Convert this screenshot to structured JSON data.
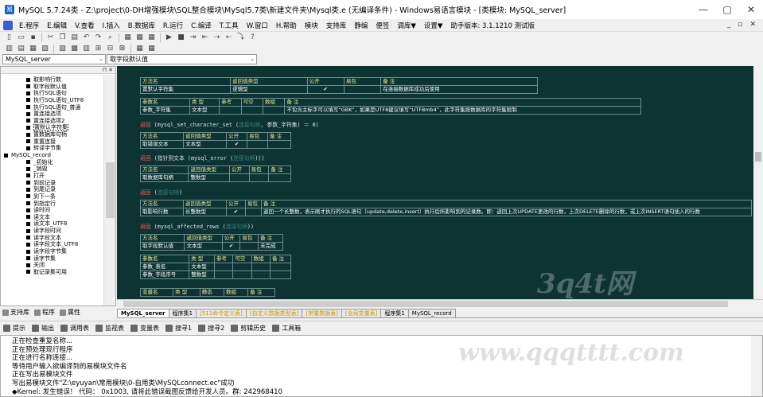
{
  "window": {
    "title": "MySQL 5.7.24类 - Z:\\project\\0-DH增强模块\\SQL整合模块\\MySql5.7类\\新建文件夹\\Mysql类.e (无编译条件) - Windows易语言模块 - [类模块: MySQL_server]",
    "controls": [
      "—",
      "▢",
      "✕"
    ]
  },
  "menu": {
    "items": [
      "E.程序",
      "E.编辑",
      "V.查看",
      "I.插入",
      "B.数据库",
      "R.运行",
      "C.编译",
      "T.工具",
      "W.窗口",
      "H.帮助",
      "模块",
      "支持库",
      "静编",
      "便签",
      "调库▼",
      "设置▼",
      "助手版本: 3.1.1210 测试版"
    ],
    "right": "_ ▫ ✕"
  },
  "combos": {
    "left": "MySQL_server",
    "right": "取字段默认值"
  },
  "tree": {
    "collapse_label": "⊓ ✕",
    "items": [
      {
        "label": "取影响行数",
        "level": 2
      },
      {
        "label": "取字段默认值",
        "level": 2
      },
      {
        "label": "执行SQL语句",
        "level": 2
      },
      {
        "label": "执行SQL语句_UTF8",
        "level": 2
      },
      {
        "label": "执行SQL语句_普通",
        "level": 2
      },
      {
        "label": "置连接选项",
        "level": 2
      },
      {
        "label": "置连接选项2",
        "level": 2
      },
      {
        "label": "置默认字符集",
        "level": 2,
        "selected": true
      },
      {
        "label": "置数据库句柄",
        "level": 2
      },
      {
        "label": "重置连接",
        "level": 2
      },
      {
        "label": "转译字节集",
        "level": 2
      },
      {
        "label": "MySQL_record",
        "level": 0
      },
      {
        "label": "_初始化",
        "level": 2
      },
      {
        "label": "_销毁",
        "level": 2
      },
      {
        "label": "打开",
        "level": 2
      },
      {
        "label": "到前记录",
        "level": 2
      },
      {
        "label": "到尾记录",
        "level": 2
      },
      {
        "label": "到下一条",
        "level": 2
      },
      {
        "label": "到指定行",
        "level": 2
      },
      {
        "label": "读时间",
        "level": 2
      },
      {
        "label": "读文本",
        "level": 2
      },
      {
        "label": "读文本_UTF8",
        "level": 2
      },
      {
        "label": "读字段时间",
        "level": 2
      },
      {
        "label": "读字段文本",
        "level": 2
      },
      {
        "label": "读字段文本_UTF8",
        "level": 2
      },
      {
        "label": "读字段字节集",
        "level": 2
      },
      {
        "label": "读字节集",
        "level": 2
      },
      {
        "label": "关闭",
        "level": 2
      },
      {
        "label": "取记录集可用",
        "level": 2
      }
    ]
  },
  "left_tabs": [
    "支持库",
    "程序",
    "属性"
  ],
  "code": {
    "t1": {
      "header": [
        "方法名",
        "返回值类型",
        "公开",
        "易包",
        "备 注"
      ],
      "row": [
        "置默认字符集",
        "逻辑型",
        "✔",
        "",
        "在连接数据库成功后使用"
      ],
      "pheader": [
        "参数名",
        "类 型",
        "参考",
        "可空",
        "数组",
        "备 注"
      ],
      "prow": [
        "参数_字符集",
        "文本型",
        "",
        "",
        "",
        "不包含主标字可以填写“GBK”，如果是UTF8建议填写“UTF8mb4”，此字符集按数据库的字符集限制"
      ]
    },
    "l1": {
      "kw": "返回",
      "text": " (mysql_set_character_set (",
      "hidden": "连接句柄",
      "tail": ", 参数_字符集) ＝ 0)"
    },
    "t2": {
      "header": [
        "方法名",
        "返回值类型",
        "公开",
        "易包",
        "备 注"
      ],
      "row": [
        "取错误文本",
        "文本型",
        "✔",
        "",
        ""
      ]
    },
    "l2": {
      "kw": "返回",
      "text": " (指针到文本 (mysql_error (",
      "hidden": "连接句柄",
      "tail": ")))"
    },
    "t3": {
      "header": [
        "方法名",
        "返回值类型",
        "公开",
        "易包",
        "备 注"
      ],
      "row": [
        "取数据库句柄",
        "整数型",
        "",
        "",
        ""
      ]
    },
    "l3": {
      "kw": "返回",
      "text": " (",
      "hidden": "连接句柄",
      "tail": ")"
    },
    "t4": {
      "header": [
        "方法名",
        "返回值类型",
        "公开",
        "易包",
        "备 注"
      ],
      "row": [
        "取影响行数",
        "长整数型",
        "✔",
        "",
        "返回一个长整数，表示刚才执行的SQL语句（update,delete,insert）执行后所影响到的记录数。即：返回上次UPDATE更改的行数，上次DELETE删除的行数，或上次INSERT语句插入的行数"
      ]
    },
    "l4": {
      "kw": "返回",
      "text": " (mysql_affected_rows (",
      "hidden": "连接句柄",
      "tail": "))"
    },
    "t5": {
      "header": [
        "方法名",
        "返回值类型",
        "公开",
        "易包",
        "备 注"
      ],
      "row": [
        "取字段默认值",
        "文本型",
        "✔",
        "",
        "未完成"
      ],
      "pheader": [
        "参数名",
        "类 型",
        "参考",
        "可空",
        "数组",
        "备 注"
      ],
      "prows": [
        [
          "参数_表名",
          "文本型",
          "",
          "",
          "",
          ""
        ],
        [
          "参数_字段序号",
          "整数型",
          "",
          "",
          "",
          ""
        ]
      ],
      "vheader": [
        "变量名",
        "类 型",
        "静态",
        "数组",
        "备 注"
      ]
    }
  },
  "watermarks": {
    "editor": "3q4t网",
    "output": "www.qqqtttt.com"
  },
  "doc_tabs": [
    {
      "label": "MySQL_server",
      "active": true
    },
    {
      "label": "程序集1"
    },
    {
      "label": "[511命令定义表]",
      "yellow": true
    },
    {
      "label": "[自定义数据类型表]",
      "yellow": true
    },
    {
      "label": "[常量数据表]",
      "yellow": true
    },
    {
      "label": "[全局变量表]",
      "yellow": true
    },
    {
      "label": "程序集1"
    },
    {
      "label": "MySQL_record"
    }
  ],
  "out_tabs": [
    "提示",
    "输出",
    "调用表",
    "监视表",
    "变量表",
    "搜寻1",
    "搜寻2",
    "剪辑历史",
    "工具箱"
  ],
  "output_lines": [
    "正在检查重复名称...",
    "正在预处理现行程序",
    "正在进行名称连接...",
    "等待用户输入欲编译到的易模块文件名",
    "正在写出易模块文件",
    "写出易模块文件\"Z:\\eyuyan\\常用模块\\0-自用类\\MySQLconnect.ec\"成功",
    "◆Kernel: 发生错误！ 代码： 0x1003, 请将此错误截图反馈给开发人员。群: 242968410"
  ]
}
